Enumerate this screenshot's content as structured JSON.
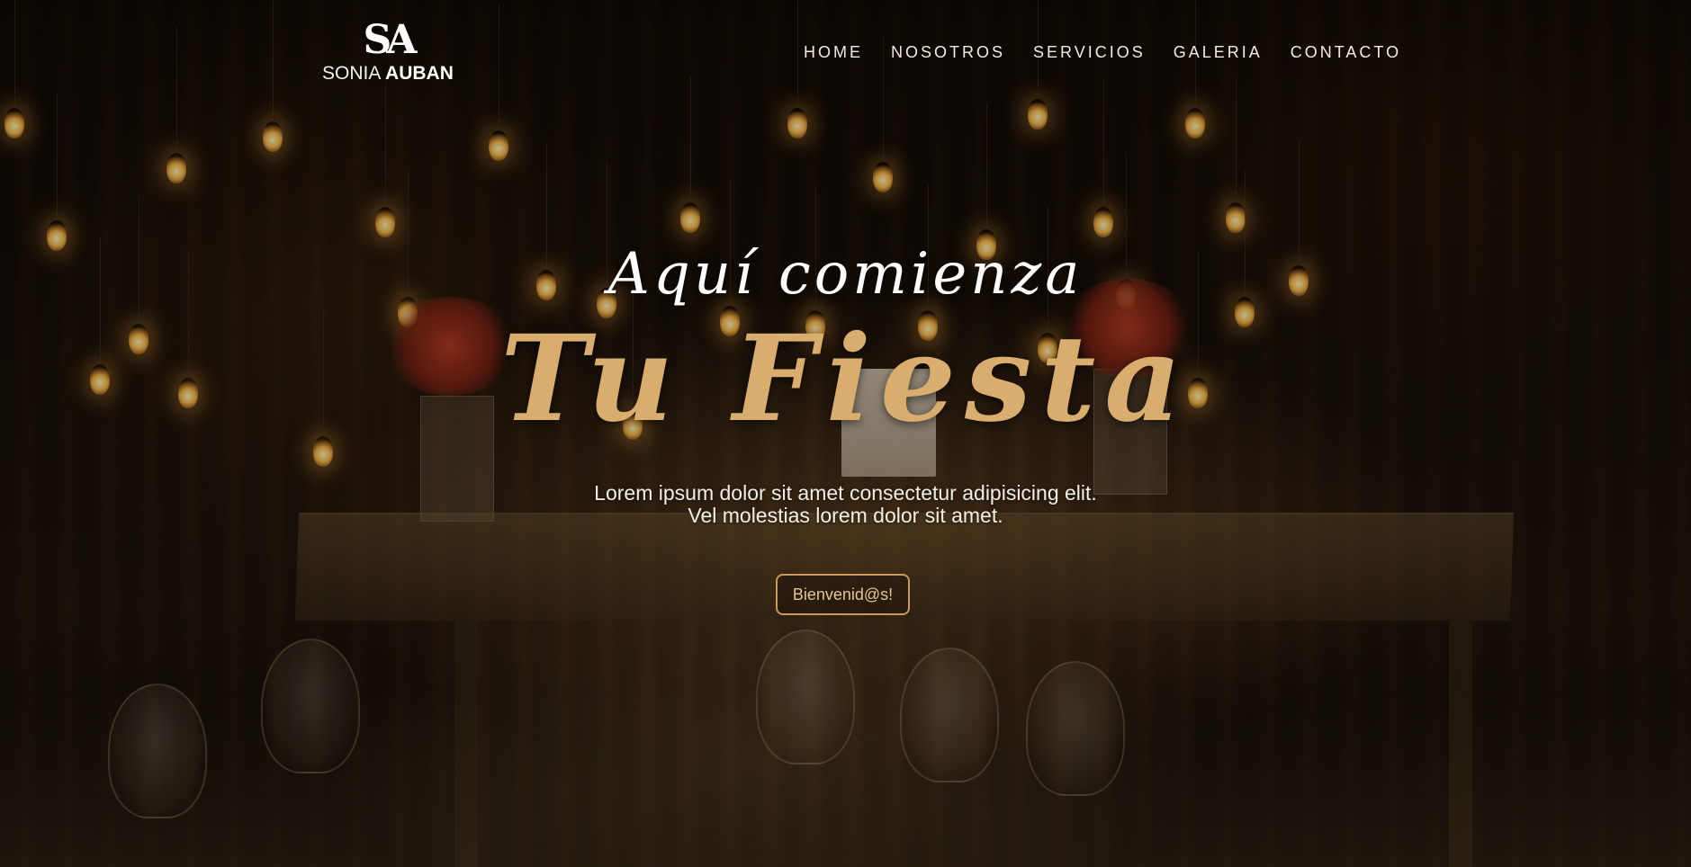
{
  "brand": {
    "mark": "SA",
    "name_light": "SONIA",
    "name_bold": "AUBAN"
  },
  "nav": {
    "items": [
      "HOME",
      "NOSOTROS",
      "SERVICIOS",
      "GALERIA",
      "CONTACTO"
    ]
  },
  "hero": {
    "subtitle": "Aquí comienza",
    "title": "Tu Fiesta",
    "description_line1": "Lorem ipsum dolor sit amet consectetur adipisicing elit.",
    "description_line2": "Vel molestias lorem dolor sit amet.",
    "cta_label": "Bienvenid@s!"
  },
  "colors": {
    "accent_gold": "#d9ad6e",
    "button_border": "#c99a5b",
    "background": "#0d0805"
  }
}
